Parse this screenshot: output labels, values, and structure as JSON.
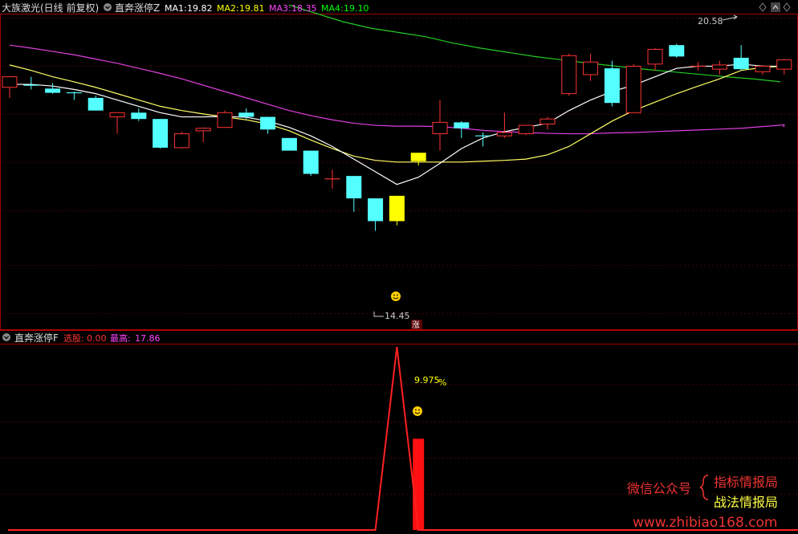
{
  "header": {
    "stock_name": "大族激光(日线 前复权)",
    "indicator": "直奔涨停Z",
    "ma_items": [
      {
        "label": "MA1:",
        "value": "19.82",
        "color": "#ffffff"
      },
      {
        "label": "MA2:",
        "value": "19.81",
        "color": "#ffff00"
      },
      {
        "label": "MA3:",
        "value": "18.35",
        "color": "#ff44ff"
      },
      {
        "label": "MA4:",
        "value": "19.10",
        "color": "#00ff00"
      }
    ]
  },
  "sub_header": {
    "indicator": "直奔涨停F",
    "items": [
      {
        "label": "选股:",
        "value": "0.00",
        "color": "#ff3333"
      },
      {
        "label": "最高:",
        "value": "17.86",
        "color": "#ff44ff"
      }
    ]
  },
  "annotations": {
    "high_label": "20.58",
    "low_label": "14.45",
    "limit_tag": "涨",
    "pct_label": "9.975",
    "pct_sign": "%"
  },
  "watermark": {
    "left": "微信公众号",
    "right1": "指标情报局",
    "right2": "战法情报局",
    "url": "www.zhibiao168.com"
  },
  "colors": {
    "up": "#ff3333",
    "down": "#54ffff",
    "signal": "#ffff00",
    "ma1": "#ffffff",
    "ma2": "#ffff66",
    "ma3": "#e040e0",
    "ma4": "#22cc22"
  },
  "chart_data": [
    {
      "type": "candlestick",
      "title": "大族激光(日线 前复权)",
      "ylim": [
        14.2,
        21.2
      ],
      "candles": [
        {
          "o": 19.55,
          "h": 19.75,
          "l": 19.3,
          "c": 19.8,
          "kind": "up"
        },
        {
          "o": 19.6,
          "h": 19.8,
          "l": 19.5,
          "c": 19.6,
          "kind": "flat"
        },
        {
          "o": 19.52,
          "h": 19.65,
          "l": 19.4,
          "c": 19.42,
          "kind": "down"
        },
        {
          "o": 19.42,
          "h": 19.45,
          "l": 19.25,
          "c": 19.4,
          "kind": "flat"
        },
        {
          "o": 19.3,
          "h": 19.35,
          "l": 19.0,
          "c": 19.0,
          "kind": "down"
        },
        {
          "o": 18.85,
          "h": 18.95,
          "l": 18.45,
          "c": 18.95,
          "kind": "up"
        },
        {
          "o": 18.95,
          "h": 19.05,
          "l": 18.75,
          "c": 18.8,
          "kind": "down"
        },
        {
          "o": 18.8,
          "h": 18.8,
          "l": 18.1,
          "c": 18.12,
          "kind": "down"
        },
        {
          "o": 18.12,
          "h": 18.5,
          "l": 18.1,
          "c": 18.45,
          "kind": "up"
        },
        {
          "o": 18.52,
          "h": 18.6,
          "l": 18.25,
          "c": 18.58,
          "kind": "up"
        },
        {
          "o": 18.6,
          "h": 19.0,
          "l": 18.6,
          "c": 18.95,
          "kind": "up"
        },
        {
          "o": 18.95,
          "h": 19.05,
          "l": 18.8,
          "c": 18.85,
          "kind": "down"
        },
        {
          "o": 18.85,
          "h": 18.85,
          "l": 18.45,
          "c": 18.55,
          "kind": "down"
        },
        {
          "o": 18.35,
          "h": 18.35,
          "l": 18.05,
          "c": 18.05,
          "kind": "down"
        },
        {
          "o": 18.05,
          "h": 18.05,
          "l": 17.45,
          "c": 17.5,
          "kind": "down"
        },
        {
          "o": 17.38,
          "h": 17.6,
          "l": 17.15,
          "c": 17.38,
          "kind": "flat"
        },
        {
          "o": 17.45,
          "h": 17.45,
          "l": 16.6,
          "c": 16.92,
          "kind": "down"
        },
        {
          "o": 16.92,
          "h": 16.92,
          "l": 16.15,
          "c": 16.38,
          "kind": "down"
        },
        {
          "o": 16.38,
          "h": 16.38,
          "l": 16.28,
          "c": 16.98,
          "kind": "signal"
        },
        {
          "o": 18.0,
          "h": 18.0,
          "l": 17.7,
          "c": 17.8,
          "kind": "signal"
        },
        {
          "o": 18.45,
          "h": 19.25,
          "l": 18.05,
          "c": 18.72,
          "kind": "up"
        },
        {
          "o": 18.72,
          "h": 18.75,
          "l": 18.35,
          "c": 18.58,
          "kind": "down"
        },
        {
          "o": 18.4,
          "h": 18.48,
          "l": 18.15,
          "c": 18.4,
          "kind": "flat"
        },
        {
          "o": 18.4,
          "h": 18.95,
          "l": 18.35,
          "c": 18.48,
          "kind": "up"
        },
        {
          "o": 18.45,
          "h": 18.65,
          "l": 18.42,
          "c": 18.65,
          "kind": "up"
        },
        {
          "o": 18.68,
          "h": 18.85,
          "l": 18.55,
          "c": 18.8,
          "kind": "up"
        },
        {
          "o": 19.4,
          "h": 20.35,
          "l": 19.35,
          "c": 20.3,
          "kind": "up"
        },
        {
          "o": 19.85,
          "h": 20.35,
          "l": 19.7,
          "c": 20.15,
          "kind": "up"
        },
        {
          "o": 20.0,
          "h": 20.18,
          "l": 19.1,
          "c": 19.18,
          "kind": "down"
        },
        {
          "o": 18.95,
          "h": 20.1,
          "l": 18.95,
          "c": 20.05,
          "kind": "up"
        },
        {
          "o": 20.1,
          "h": 20.48,
          "l": 19.95,
          "c": 20.45,
          "kind": "up"
        },
        {
          "o": 20.55,
          "h": 20.58,
          "l": 20.25,
          "c": 20.28,
          "kind": "down"
        },
        {
          "o": 20.02,
          "h": 20.15,
          "l": 19.95,
          "c": 20.05,
          "kind": "flat"
        },
        {
          "o": 19.98,
          "h": 20.18,
          "l": 19.85,
          "c": 20.08,
          "kind": "up"
        },
        {
          "o": 20.25,
          "h": 20.55,
          "l": 19.95,
          "c": 19.98,
          "kind": "down"
        },
        {
          "o": 19.92,
          "h": 20.08,
          "l": 19.85,
          "c": 20.05,
          "kind": "up"
        },
        {
          "o": 19.98,
          "h": 20.22,
          "l": 19.85,
          "c": 20.2,
          "kind": "up"
        }
      ],
      "ma1": [
        19.62,
        19.62,
        19.58,
        19.5,
        19.4,
        19.25,
        19.1,
        18.95,
        18.85,
        18.85,
        18.86,
        18.84,
        18.75,
        18.6,
        18.4,
        18.15,
        17.85,
        17.55,
        17.25,
        17.42,
        17.75,
        18.1,
        18.35,
        18.5,
        18.6,
        18.7,
        19.0,
        19.25,
        19.45,
        19.6,
        19.8,
        20.0,
        20.05,
        20.05,
        20.1,
        20.05,
        20.05
      ],
      "ma2": [
        20.08,
        19.95,
        19.8,
        19.68,
        19.55,
        19.4,
        19.25,
        19.1,
        19.0,
        18.92,
        18.85,
        18.78,
        18.68,
        18.52,
        18.3,
        18.1,
        17.92,
        17.82,
        17.78,
        17.78,
        17.78,
        17.78,
        17.8,
        17.82,
        17.85,
        17.95,
        18.15,
        18.45,
        18.75,
        19.0,
        19.2,
        19.4,
        19.58,
        19.75,
        19.95,
        20.02,
        20.05
      ],
      "ma3": [
        20.55,
        20.48,
        20.4,
        20.32,
        20.22,
        20.12,
        20.0,
        19.88,
        19.75,
        19.6,
        19.45,
        19.3,
        19.15,
        19.0,
        18.88,
        18.78,
        18.7,
        18.65,
        18.63,
        18.63,
        18.62,
        18.58,
        18.53,
        18.5,
        18.48,
        18.46,
        18.45,
        18.45,
        18.47,
        18.48,
        18.5,
        18.52,
        18.54,
        18.56,
        18.58,
        18.62,
        18.66
      ],
      "ma4": [
        21.5,
        21.3,
        21.1,
        20.95,
        20.85,
        20.75,
        20.6,
        20.48,
        20.38,
        20.28,
        20.2,
        20.12,
        20.05,
        19.98,
        19.92,
        19.86,
        19.8,
        19.75,
        19.68
      ]
    },
    {
      "type": "line",
      "title": "直奔涨停F",
      "ylim": [
        0,
        17.86
      ],
      "values": [
        0,
        0,
        0,
        0,
        0,
        0,
        0,
        0,
        0,
        0,
        0,
        0,
        0,
        0,
        0,
        0,
        0,
        0,
        17.86,
        0,
        0,
        0,
        0,
        0,
        0,
        0,
        0,
        0,
        0,
        0,
        0,
        0,
        0,
        0,
        0,
        0,
        0
      ],
      "bar": {
        "index": 19,
        "value": 8.9
      }
    }
  ]
}
